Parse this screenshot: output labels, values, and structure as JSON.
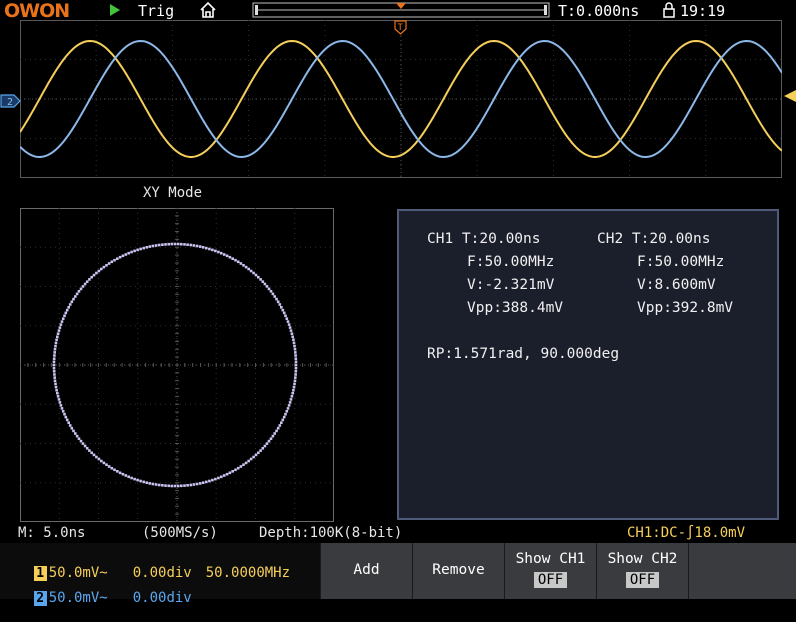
{
  "topbar": {
    "logo": "OWON",
    "trig_label": "Trig",
    "time_offset": "T:0.000ns",
    "clock": "19:19",
    "run_state_color": "#43c43a"
  },
  "waveform": {
    "ch1_color": "#f5cf5a",
    "ch2_color": "#8cb9ea",
    "trigger_marker": "T",
    "ch2_marker": "2"
  },
  "xy": {
    "label": "XY Mode",
    "trace_color": "#c9c4ef"
  },
  "measurements": {
    "ch1": {
      "title": "CH1 T:20.00ns",
      "freq": "F:50.00MHz",
      "v": "V:-2.321mV",
      "vpp": "Vpp:388.4mV"
    },
    "ch2": {
      "title": "CH2 T:20.00ns",
      "freq": "F:50.00MHz",
      "v": "V:8.600mV",
      "vpp": "Vpp:392.8mV"
    },
    "phase": "RP:1.571rad, 90.000deg"
  },
  "status": {
    "timebase": "M: 5.0ns",
    "sample_rate": "(500MS/s)",
    "depth": "Depth:100K(8-bit)",
    "trigger": "CH1:DC-∫18.0mV"
  },
  "channels": [
    {
      "num": "1",
      "scale": "50.0mV~",
      "offset": "0.00div",
      "freq": "50.0000MHz",
      "color": "#f5cf5a"
    },
    {
      "num": "2",
      "scale": "50.0mV~",
      "offset": "0.00div",
      "freq": "",
      "color": "#5aa6ee"
    }
  ],
  "menu": {
    "add": "Add",
    "remove": "Remove",
    "show_ch1": "Show CH1",
    "show_ch1_state": "OFF",
    "show_ch2": "Show CH2",
    "show_ch2_state": "OFF"
  }
}
